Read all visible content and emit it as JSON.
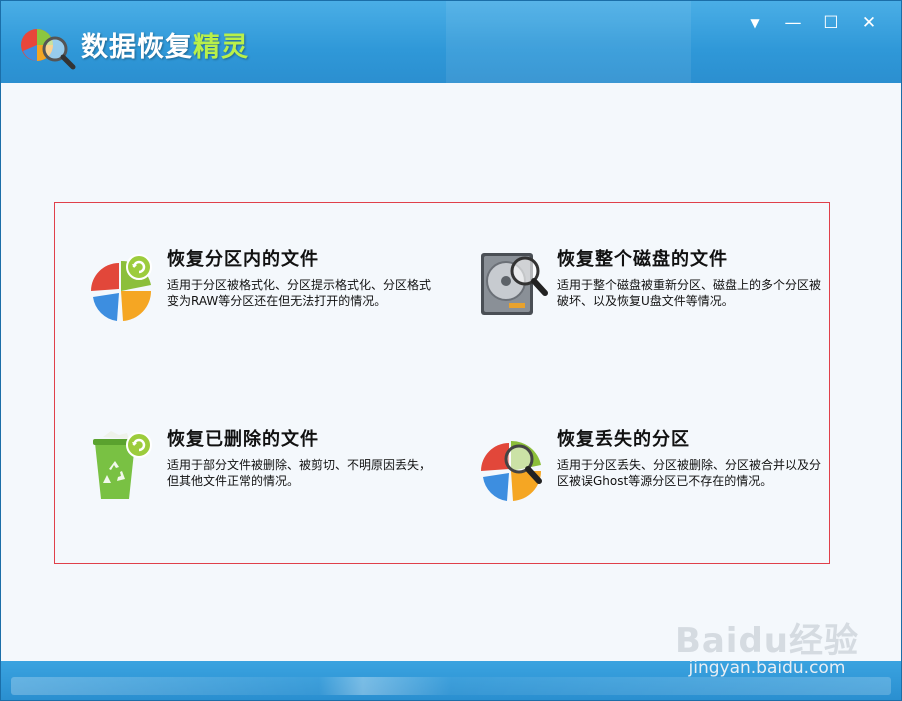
{
  "window": {
    "title_main": "数据恢复",
    "title_accent": "精灵",
    "controls": {
      "menu_icon": "▼",
      "minimize_icon": "—",
      "maximize_icon": "☐",
      "close_icon": "✕"
    }
  },
  "options": [
    {
      "title": "恢复分区内的文件",
      "description": "适用于分区被格式化、分区提示格式化、分区格式变为RAW等分区还在但无法打开的情况。",
      "icon": "pie-recover-icon"
    },
    {
      "title": "恢复整个磁盘的文件",
      "description": "适用于整个磁盘被重新分区、磁盘上的多个分区被破坏、以及恢复U盘文件等情况。",
      "icon": "hard-disk-magnifier-icon"
    },
    {
      "title": "恢复已删除的文件",
      "description": "适用于部分文件被删除、被剪切、不明原因丢失，但其他文件正常的情况。",
      "icon": "recycle-bin-icon"
    },
    {
      "title": "恢复丢失的分区",
      "description": "适用于分区丢失、分区被删除、分区被合并以及分区被误Ghost等源分区已不存在的情况。",
      "icon": "pie-magnifier-icon"
    }
  ],
  "watermark": {
    "logo": "Baidu经验",
    "url": "jingyan.baidu.com"
  },
  "colors": {
    "titlebar": "#2f98d8",
    "accent_green": "#b9f04a",
    "highlight_border": "#e0404a"
  }
}
